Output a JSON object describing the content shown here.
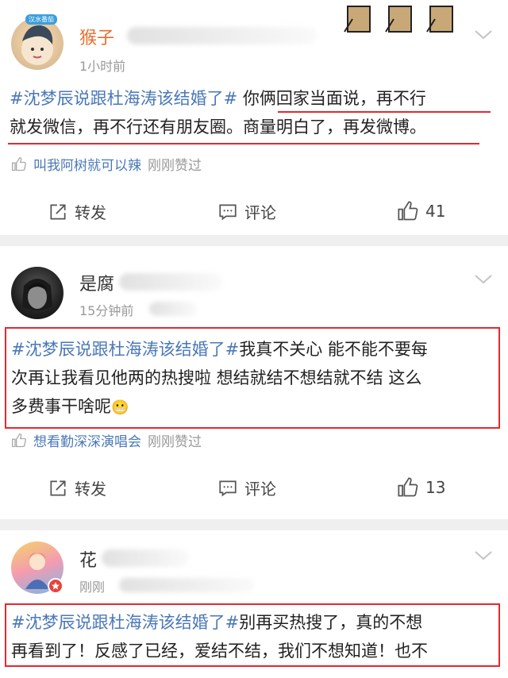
{
  "posts": [
    {
      "username": "猴子",
      "time": "1小时前",
      "topic": "#沈梦辰说跟杜海涛该结婚了#",
      "text_line1": " 你俩回家当面说，再不行",
      "text_line2": "就发微信，再不行还有朋友圈。商量明白了，再发微博。",
      "liker": "叫我阿树就可以辣",
      "like_action": "刚刚赞过",
      "avatar_badge": "汉水番茄",
      "repost_label": "转发",
      "comment_label": "评论",
      "like_count": "41"
    },
    {
      "username": "是腐",
      "time": "15分钟前",
      "topic": "#沈梦辰说跟杜海涛该结婚了#",
      "text_line1": "我真不关心 能不能不要每",
      "text_line2": "次再让我看见他两的热搜啦 想结就结不想结就不结 这么",
      "text_line3": "多费事干啥呢",
      "emoji": "😬",
      "liker": "想看勤深深演唱会",
      "like_action": "刚刚赞过",
      "repost_label": "转发",
      "comment_label": "评论",
      "like_count": "13"
    },
    {
      "username": "花",
      "time": "刚刚",
      "topic": "#沈梦辰说跟杜海涛该结婚了#",
      "text_line1": "别再买热搜了，真的不想",
      "text_line2": "再看到了！反感了已经，爱结不结，我们不想知道！也不"
    }
  ],
  "colors": {
    "topic": "#4a78b8",
    "highlight_red": "#e3292f",
    "vip_name": "#e86c2b",
    "meta": "#999999"
  },
  "icons": [
    "thumb-up-icon",
    "repost-icon",
    "comment-icon",
    "chevron-down-icon",
    "verified-badge-icon"
  ]
}
